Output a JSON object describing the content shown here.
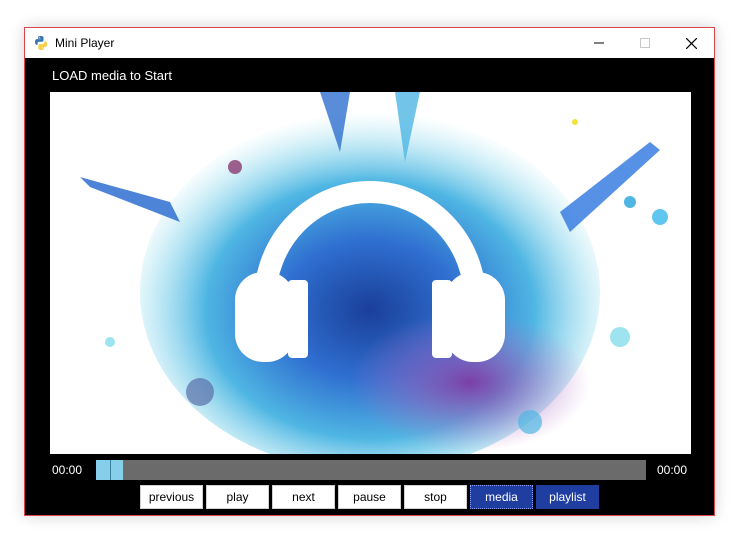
{
  "window": {
    "title": "Mini Player",
    "minimize_icon": "minimize-icon",
    "maximize_icon": "maximize-icon",
    "close_icon": "close-icon"
  },
  "player": {
    "status": "LOAD media to Start",
    "elapsed": "00:00",
    "total": "00:00",
    "progress": 0.04,
    "artwork": "headphones-splash-icon"
  },
  "controls": {
    "previous": "previous",
    "play": "play",
    "next": "next",
    "pause": "pause",
    "stop": "stop",
    "media": "media",
    "playlist": "playlist"
  },
  "colors": {
    "accent": "#1f3ea0",
    "progress": "#87ceeb",
    "track": "#6b6b6b"
  }
}
